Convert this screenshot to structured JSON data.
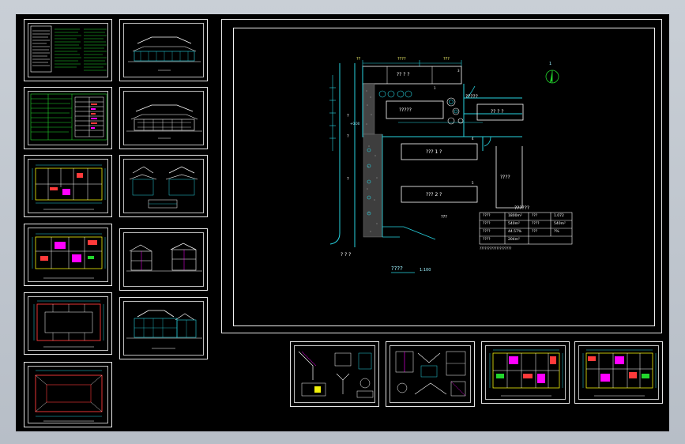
{
  "viewer": {
    "background": "#000000",
    "colors": {
      "cyan": "#27d3e0",
      "green": "#22d62c",
      "yellow": "#f2f20a",
      "red": "#ff3a3a",
      "magenta": "#ff00ff",
      "white": "#ffffff"
    }
  },
  "thumbnails": {
    "left_col": [
      "design-notes-sheet",
      "material-table-sheet",
      "floor-plan-1",
      "floor-plan-2",
      "floor-plan-3",
      "roof-plan"
    ],
    "mid_col": [
      "elevation-front",
      "elevation-rear",
      "elevation-sides",
      "section-sheet",
      "elevation-long"
    ],
    "bottom_row": [
      "detail-sheet-1",
      "detail-sheet-2",
      "floor-plan-color-1",
      "floor-plan-color-2"
    ]
  },
  "site_plan": {
    "dim_top_left": "??",
    "dim_top_mid": "????",
    "dim_top_right": "???",
    "north_label": "1",
    "buildings": {
      "top_block": "?? ? ?",
      "courtyard_block": "?????",
      "right_top_block": "?? ? ?",
      "mid_block": "???  1 ?",
      "lower_block": "???  2 ?",
      "right_block": "????",
      "east_label": "?????"
    },
    "left_labels": {
      "side_a": "?",
      "side_b": "?",
      "side_c": "?",
      "level_mark": "+0.00",
      "road": "? ? ?"
    },
    "small_label": "???",
    "table_title": "??????",
    "table_rows": [
      [
        "????",
        "1800m²",
        "???",
        "1.072"
      ],
      [
        "????",
        "540m²",
        "????",
        "540m²"
      ],
      [
        "????",
        "44.57%",
        "???",
        "?%"
      ],
      [
        "????",
        "204m²",
        "",
        ""
      ]
    ],
    "table_note": "???????????????????",
    "title": "????",
    "scale": "1:100",
    "num_labels": [
      "1",
      "3",
      "4",
      "5"
    ]
  }
}
